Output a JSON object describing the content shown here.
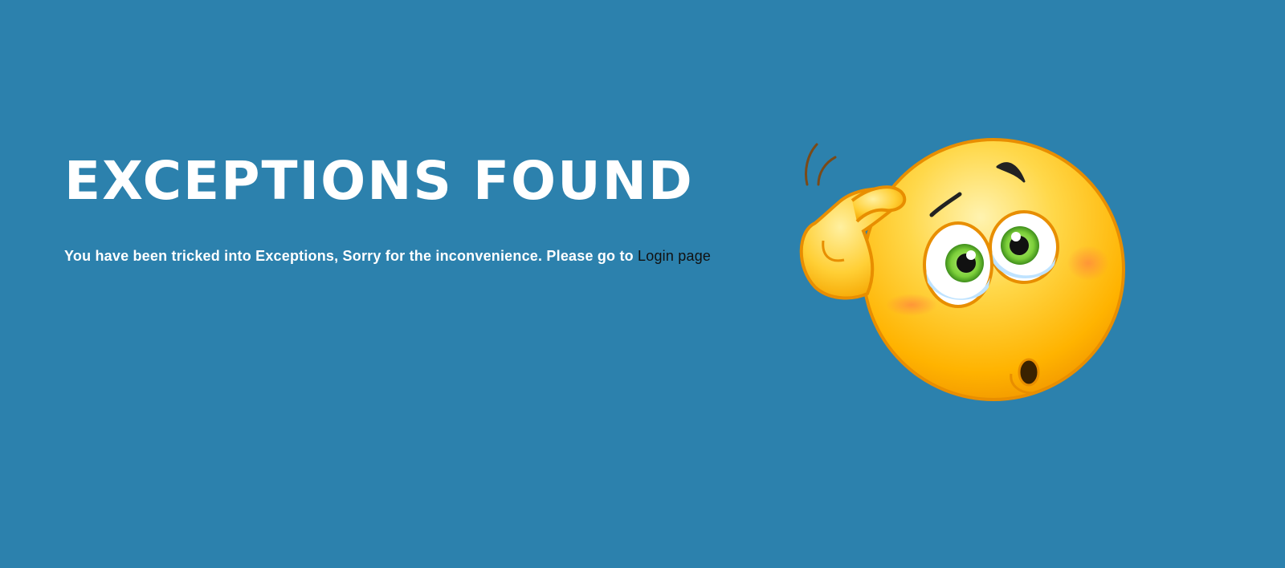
{
  "page": {
    "title": "EXCEPTIONS FOUND",
    "message_text": "You have been tricked into Exceptions, Sorry for the inconvenience. Please go to ",
    "link_label": "Login page",
    "colors": {
      "background": "#2c81ad",
      "title_text": "#ffffff",
      "message_text": "#ffffff",
      "link_text": "#111111"
    }
  },
  "illustration": {
    "icon": "confused-face-icon"
  }
}
